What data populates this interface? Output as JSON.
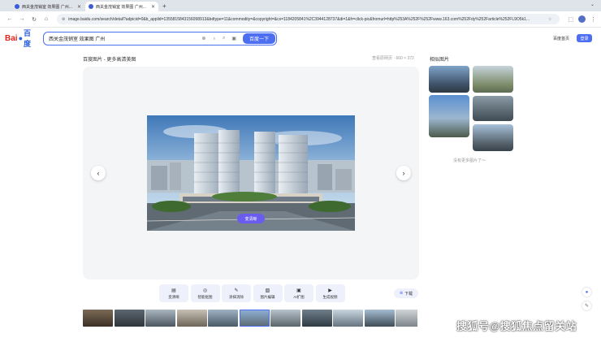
{
  "browser": {
    "tabs": [
      {
        "title": "西关金茂销室 效果图 广州...",
        "active": false
      },
      {
        "title": "西关金茂销室 效果图 广州...",
        "active": true
      }
    ],
    "url": "image.baidu.com/search/detail?adpicid=0&b_applid=1355815843156098913&bdtype=11&commodity=&copyright=&cs=1184205841%2C3944128737&di=1&fr=click-pic&fromurl=http%253A%252F%252Fwww.163.com%252Fdy%252Farticle%252FL9O5k1...",
    "new_tab": "+"
  },
  "baidu": {
    "query": "西关金茂销室 效果图 广州",
    "search_button": "百度一下",
    "home_link": "百度首页",
    "login": "登录"
  },
  "viewer": {
    "title": "百度图片 - 更多高清美图",
    "size_text": "查看原网页 · 660 × 372",
    "hd_button": "变清晰"
  },
  "tools": [
    {
      "label": "变清晰",
      "icon": "hd-icon"
    },
    {
      "label": "智能抠图",
      "icon": "cutout-icon"
    },
    {
      "label": "涂抹消除",
      "icon": "eraser-icon"
    },
    {
      "label": "图片编辑",
      "icon": "edit-icon"
    },
    {
      "label": "AI扩图",
      "icon": "expand-icon"
    },
    {
      "label": "生成视频",
      "icon": "video-icon"
    }
  ],
  "download": "下载",
  "related": {
    "title": "相似图片",
    "no_more": "没有更多图片了～"
  },
  "watermark": "搜狐号@搜狐焦点留关站"
}
